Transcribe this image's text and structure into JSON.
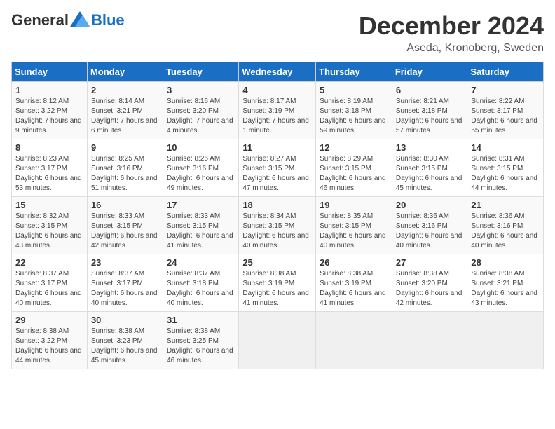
{
  "logo": {
    "general": "General",
    "blue": "Blue"
  },
  "title": "December 2024",
  "location": "Aseda, Kronoberg, Sweden",
  "days_of_week": [
    "Sunday",
    "Monday",
    "Tuesday",
    "Wednesday",
    "Thursday",
    "Friday",
    "Saturday"
  ],
  "weeks": [
    [
      {
        "day": "1",
        "sunrise": "Sunrise: 8:12 AM",
        "sunset": "Sunset: 3:22 PM",
        "daylight": "Daylight: 7 hours and 9 minutes."
      },
      {
        "day": "2",
        "sunrise": "Sunrise: 8:14 AM",
        "sunset": "Sunset: 3:21 PM",
        "daylight": "Daylight: 7 hours and 6 minutes."
      },
      {
        "day": "3",
        "sunrise": "Sunrise: 8:16 AM",
        "sunset": "Sunset: 3:20 PM",
        "daylight": "Daylight: 7 hours and 4 minutes."
      },
      {
        "day": "4",
        "sunrise": "Sunrise: 8:17 AM",
        "sunset": "Sunset: 3:19 PM",
        "daylight": "Daylight: 7 hours and 1 minute."
      },
      {
        "day": "5",
        "sunrise": "Sunrise: 8:19 AM",
        "sunset": "Sunset: 3:18 PM",
        "daylight": "Daylight: 6 hours and 59 minutes."
      },
      {
        "day": "6",
        "sunrise": "Sunrise: 8:21 AM",
        "sunset": "Sunset: 3:18 PM",
        "daylight": "Daylight: 6 hours and 57 minutes."
      },
      {
        "day": "7",
        "sunrise": "Sunrise: 8:22 AM",
        "sunset": "Sunset: 3:17 PM",
        "daylight": "Daylight: 6 hours and 55 minutes."
      }
    ],
    [
      {
        "day": "8",
        "sunrise": "Sunrise: 8:23 AM",
        "sunset": "Sunset: 3:17 PM",
        "daylight": "Daylight: 6 hours and 53 minutes."
      },
      {
        "day": "9",
        "sunrise": "Sunrise: 8:25 AM",
        "sunset": "Sunset: 3:16 PM",
        "daylight": "Daylight: 6 hours and 51 minutes."
      },
      {
        "day": "10",
        "sunrise": "Sunrise: 8:26 AM",
        "sunset": "Sunset: 3:16 PM",
        "daylight": "Daylight: 6 hours and 49 minutes."
      },
      {
        "day": "11",
        "sunrise": "Sunrise: 8:27 AM",
        "sunset": "Sunset: 3:15 PM",
        "daylight": "Daylight: 6 hours and 47 minutes."
      },
      {
        "day": "12",
        "sunrise": "Sunrise: 8:29 AM",
        "sunset": "Sunset: 3:15 PM",
        "daylight": "Daylight: 6 hours and 46 minutes."
      },
      {
        "day": "13",
        "sunrise": "Sunrise: 8:30 AM",
        "sunset": "Sunset: 3:15 PM",
        "daylight": "Daylight: 6 hours and 45 minutes."
      },
      {
        "day": "14",
        "sunrise": "Sunrise: 8:31 AM",
        "sunset": "Sunset: 3:15 PM",
        "daylight": "Daylight: 6 hours and 44 minutes."
      }
    ],
    [
      {
        "day": "15",
        "sunrise": "Sunrise: 8:32 AM",
        "sunset": "Sunset: 3:15 PM",
        "daylight": "Daylight: 6 hours and 43 minutes."
      },
      {
        "day": "16",
        "sunrise": "Sunrise: 8:33 AM",
        "sunset": "Sunset: 3:15 PM",
        "daylight": "Daylight: 6 hours and 42 minutes."
      },
      {
        "day": "17",
        "sunrise": "Sunrise: 8:33 AM",
        "sunset": "Sunset: 3:15 PM",
        "daylight": "Daylight: 6 hours and 41 minutes."
      },
      {
        "day": "18",
        "sunrise": "Sunrise: 8:34 AM",
        "sunset": "Sunset: 3:15 PM",
        "daylight": "Daylight: 6 hours and 40 minutes."
      },
      {
        "day": "19",
        "sunrise": "Sunrise: 8:35 AM",
        "sunset": "Sunset: 3:15 PM",
        "daylight": "Daylight: 6 hours and 40 minutes."
      },
      {
        "day": "20",
        "sunrise": "Sunrise: 8:36 AM",
        "sunset": "Sunset: 3:16 PM",
        "daylight": "Daylight: 6 hours and 40 minutes."
      },
      {
        "day": "21",
        "sunrise": "Sunrise: 8:36 AM",
        "sunset": "Sunset: 3:16 PM",
        "daylight": "Daylight: 6 hours and 40 minutes."
      }
    ],
    [
      {
        "day": "22",
        "sunrise": "Sunrise: 8:37 AM",
        "sunset": "Sunset: 3:17 PM",
        "daylight": "Daylight: 6 hours and 40 minutes."
      },
      {
        "day": "23",
        "sunrise": "Sunrise: 8:37 AM",
        "sunset": "Sunset: 3:17 PM",
        "daylight": "Daylight: 6 hours and 40 minutes."
      },
      {
        "day": "24",
        "sunrise": "Sunrise: 8:37 AM",
        "sunset": "Sunset: 3:18 PM",
        "daylight": "Daylight: 6 hours and 40 minutes."
      },
      {
        "day": "25",
        "sunrise": "Sunrise: 8:38 AM",
        "sunset": "Sunset: 3:19 PM",
        "daylight": "Daylight: 6 hours and 41 minutes."
      },
      {
        "day": "26",
        "sunrise": "Sunrise: 8:38 AM",
        "sunset": "Sunset: 3:19 PM",
        "daylight": "Daylight: 6 hours and 41 minutes."
      },
      {
        "day": "27",
        "sunrise": "Sunrise: 8:38 AM",
        "sunset": "Sunset: 3:20 PM",
        "daylight": "Daylight: 6 hours and 42 minutes."
      },
      {
        "day": "28",
        "sunrise": "Sunrise: 8:38 AM",
        "sunset": "Sunset: 3:21 PM",
        "daylight": "Daylight: 6 hours and 43 minutes."
      }
    ],
    [
      {
        "day": "29",
        "sunrise": "Sunrise: 8:38 AM",
        "sunset": "Sunset: 3:22 PM",
        "daylight": "Daylight: 6 hours and 44 minutes."
      },
      {
        "day": "30",
        "sunrise": "Sunrise: 8:38 AM",
        "sunset": "Sunset: 3:23 PM",
        "daylight": "Daylight: 6 hours and 45 minutes."
      },
      {
        "day": "31",
        "sunrise": "Sunrise: 8:38 AM",
        "sunset": "Sunset: 3:25 PM",
        "daylight": "Daylight: 6 hours and 46 minutes."
      },
      null,
      null,
      null,
      null
    ]
  ]
}
